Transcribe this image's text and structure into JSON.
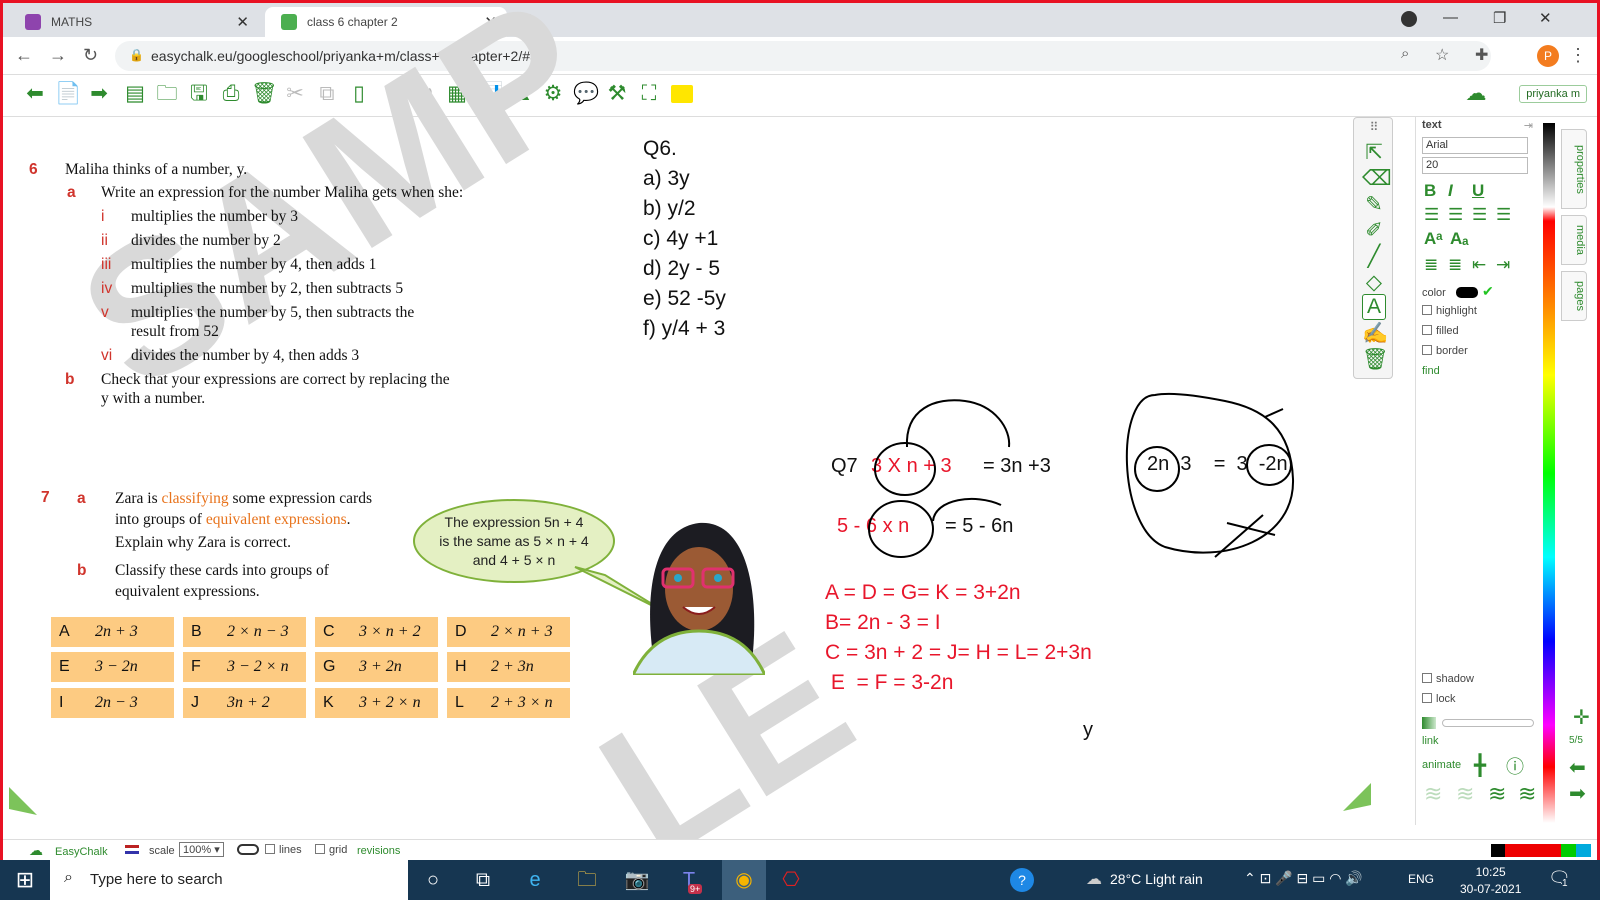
{
  "browser": {
    "tabs": [
      {
        "label": "MATHS",
        "icon": "classroom-icon",
        "active": false
      },
      {
        "label": "class 6 chapter 2",
        "icon": "easychalk-icon",
        "active": true
      }
    ],
    "url": "easychalk.eu/googleschool/priyanka+m/class+6+chapter+2/#5",
    "profile_initial": "P"
  },
  "toolbar": {
    "user": "priyanka m"
  },
  "textbook": {
    "q6": {
      "number": "6",
      "stem": "Maliha thinks of a number, y.",
      "a_label": "a",
      "a_text": "Write an expression for the number Maliha gets when she:",
      "items": [
        {
          "n": "i",
          "text": "multiplies the number by 3"
        },
        {
          "n": "ii",
          "text": "divides the number by 2"
        },
        {
          "n": "iii",
          "text": "multiplies the number by 4, then adds 1"
        },
        {
          "n": "iv",
          "text": "multiplies the number by 2, then subtracts 5"
        },
        {
          "n": "v",
          "text": "multiplies the number by 5, then subtracts the",
          "text2": "result from 52"
        },
        {
          "n": "vi",
          "text": "divides the number by 4, then adds 3"
        }
      ],
      "b_label": "b",
      "b_text": "Check that your expressions are correct by replacing the",
      "b_text2": "y with a number."
    },
    "q7": {
      "number": "7",
      "a_label": "a",
      "a_line1_pre": "Zara is ",
      "a_line1_hl": "classifying",
      "a_line1_post": " some expression cards",
      "a_line2_pre": "into groups of ",
      "a_line2_hl": "equivalent expressions",
      "a_line2_post": ".",
      "a_line3": "Explain why Zara is correct.",
      "b_label": "b",
      "b_text": "Classify these cards into groups of",
      "b_text2": "equivalent expressions.",
      "bubble": [
        "The expression 5n + 4",
        "is the same as 5 × n + 4",
        "and 4 + 5 × n"
      ],
      "cards": [
        {
          "letter": "A",
          "expr": "2n + 3"
        },
        {
          "letter": "B",
          "expr": "2 × n − 3"
        },
        {
          "letter": "C",
          "expr": "3 × n + 2"
        },
        {
          "letter": "D",
          "expr": "2 × n + 3"
        },
        {
          "letter": "E",
          "expr": "3 − 2n"
        },
        {
          "letter": "F",
          "expr": "3 − 2 × n"
        },
        {
          "letter": "G",
          "expr": "3 + 2n"
        },
        {
          "letter": "H",
          "expr": "2 + 3n"
        },
        {
          "letter": "I",
          "expr": "2n − 3"
        },
        {
          "letter": "J",
          "expr": "3n + 2"
        },
        {
          "letter": "K",
          "expr": "3 + 2 × n"
        },
        {
          "letter": "L",
          "expr": "2 + 3 × n"
        }
      ]
    },
    "watermark": [
      "SAMP",
      "LE"
    ]
  },
  "answers": {
    "q6": [
      "Q6.",
      "a) 3y",
      "b) y/2",
      "c) 4y +1",
      "d) 2y - 5",
      "e) 52 -5y",
      "f) y/4  + 3"
    ],
    "q7_label": "Q7",
    "q7_line1_red": "3 X n  +   3",
    "q7_line1_black": "= 3n +3",
    "q7_line2_red": "5 -  6 x n",
    "q7_line2_black": "= 5 - 6n",
    "right_expr": "2n  3    =  3  -2n",
    "groups": [
      "A = D = G= K = 3+2n",
      "B=  2n - 3 = I",
      "C = 3n + 2 = J= H = L= 2+3n",
      " E  = F = 3-2n"
    ],
    "stray": "y"
  },
  "properties": {
    "title": "text",
    "font": "Arial",
    "size": "20",
    "color_label": "color",
    "checks_top": [
      "highlight",
      "filled",
      "border"
    ],
    "find": "find",
    "checks_bottom": [
      "shadow",
      "lock"
    ],
    "link": "link",
    "animate": "animate",
    "tabs": [
      "properties",
      "media",
      "pages"
    ],
    "page_count": "5/5"
  },
  "statusbar": {
    "brand": "EasyChalk",
    "scale_label": "scale",
    "scale_value": "100%",
    "lines": "lines",
    "grid": "grid",
    "revisions": "revisions"
  },
  "taskbar": {
    "search_placeholder": "Type here to search",
    "teams_badge": "9+",
    "weather": "28°C  Light rain",
    "lang": "ENG",
    "time": "10:25",
    "date": "30-07-2021",
    "notif_count": "1"
  },
  "colors": {
    "accent_green": "#2e8b2e",
    "ink_red": "#e8162b",
    "card_orange": "#fdcb82",
    "frame_red": "#e81123"
  }
}
